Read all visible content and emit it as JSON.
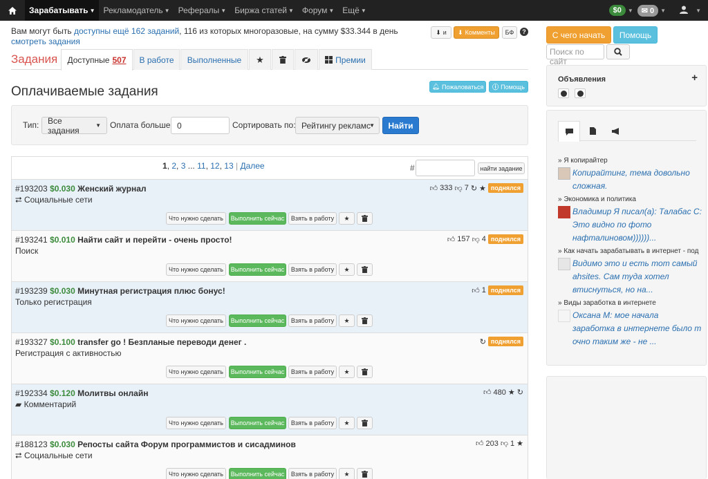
{
  "nav": {
    "items": [
      "Зарабатывать",
      "Рекламодатель",
      "Рефералы",
      "Биржа статей",
      "Форум",
      "Ещё"
    ],
    "balance": "$0",
    "mail": "0"
  },
  "info": {
    "text1": "Вам могут быть ",
    "link1": "доступны ещё 162 заданий",
    "text2": ", 116 из которых многоразовые, на сумму $33.344 в день ",
    "link2": "смотреть задания"
  },
  "toolbar": {
    "download_label": "и",
    "comments_label": "Комменты",
    "bf_label": "БФ",
    "help_q": "?"
  },
  "tabs": {
    "title": "Задания",
    "available_label": "Доступные",
    "available_count": "507",
    "in_work": "В работе",
    "done": "Выполненные",
    "bonuses": "Премии"
  },
  "page": {
    "title": "Оплачиваемые задания",
    "complain": "Пожаловаться",
    "help": "Помощь"
  },
  "filter": {
    "type_label": "Тип:",
    "type_value": "Все задания",
    "pay_label": "Оплата больше:",
    "pay_value": "0",
    "sort_label": "Сортировать по:",
    "sort_value": "Рейтингу рекламс",
    "find": "Найти"
  },
  "pager": {
    "p1": "1",
    "p2": "2",
    "p3": "3",
    "dots": "...",
    "p11": "11",
    "p12": "12",
    "p13": "13",
    "sep": "|",
    "next": "Далее",
    "hash": "#",
    "find_task": "найти задание"
  },
  "actions": {
    "what": "Что нужно сделать",
    "do_now": "Выполнить сейчас",
    "take": "Взять в работу"
  },
  "tasks": [
    {
      "id": "#193203",
      "price": "$0.030",
      "name": "Женский журнал",
      "category": "Социальные сети",
      "likes": "333",
      "dislikes": "7",
      "raised": "поднялся"
    },
    {
      "id": "#193241",
      "price": "$0.010",
      "name": "Найти сайт и перейти - очень просто!",
      "category": "Поиск",
      "likes": "157",
      "dislikes": "4",
      "raised": "поднялся"
    },
    {
      "id": "#193239",
      "price": "$0.030",
      "name": "Минутная регистрация плюс бонус!",
      "category": "Только регистрация",
      "likes": "1",
      "raised": "поднялся"
    },
    {
      "id": "#193327",
      "price": "$0.100",
      "name": "transfer go ! Безпланые переводи денег .",
      "category": "Регистрация с активностью",
      "raised": "поднялся"
    },
    {
      "id": "#192334",
      "price": "$0.120",
      "name": "Молитвы онлайн",
      "category": "Комментарий",
      "likes": "480"
    },
    {
      "id": "#188123",
      "price": "$0.030",
      "name": "Репосты сайта Форум программистов и сисадминов",
      "category": "Социальные сети",
      "likes": "203",
      "dislikes": "1"
    }
  ],
  "sidebar": {
    "start": "С чего начать",
    "help": "Помощь",
    "search_placeholder": "Поиск по сайт",
    "ads_title": "Объявления",
    "ads_plus": "+",
    "feed": [
      {
        "topic": "» Я копирайтер",
        "comment": "Копирайтинг, тема довольно сложная."
      },
      {
        "topic": "» Экономика и политика",
        "comment": "Владимир Я писал(а): Талабас С: Это видно по фото нафталиновом))))))..."
      },
      {
        "topic": "» Как начать зарабатывать в интернет - под",
        "comment": "Видимо это и есть тот самый ahsites. Сам туда хотел втиснуться, но на..."
      },
      {
        "topic": "» Виды заработка в интернете",
        "comment": "Оксана М: мое начала заработка в интернете было т очно таким же - не ..."
      }
    ]
  },
  "colors": {
    "navbar": "#222222",
    "orange": "#f0a030",
    "green": "#5cb85c",
    "blue_btn": "#2a7bd0",
    "link": "#2a6fb0",
    "title_red": "#d9534f",
    "row_blue": "#e8f0f8"
  },
  "icons": [
    "home-icon",
    "user-icon",
    "envelope-icon",
    "download-icon",
    "star-icon",
    "trash-icon",
    "eye-slash-icon",
    "gift-icon",
    "bell-icon",
    "info-icon",
    "retweet-icon",
    "thumbs-up-icon",
    "thumbs-down-icon",
    "refresh-icon",
    "comment-icon",
    "file-icon",
    "bullhorn-icon",
    "search-icon"
  ]
}
